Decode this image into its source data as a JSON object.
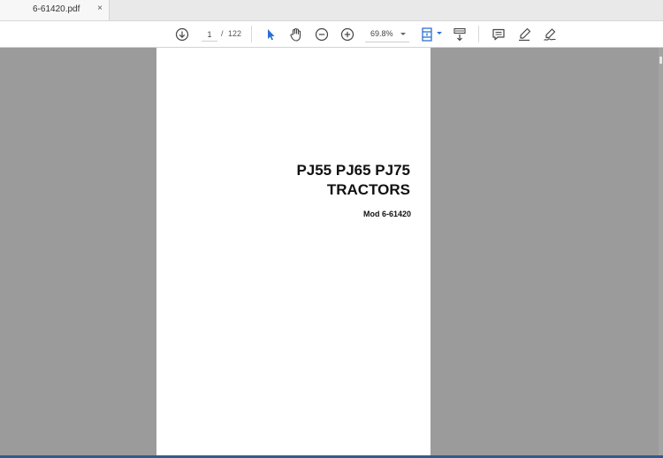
{
  "tab": {
    "title": "6-61420.pdf",
    "close_glyph": "×"
  },
  "toolbar": {
    "download_icon": "download-circle-icon",
    "page_current": "1",
    "page_separator": "/",
    "page_total": "122",
    "select_icon": "cursor-arrow-icon",
    "hand_icon": "hand-pan-icon",
    "zoom_out_icon": "zoom-out-circle-icon",
    "zoom_in_icon": "zoom-in-circle-icon",
    "zoom_value": "69.8%",
    "fit_icon": "fit-page-icon",
    "scroll_icon": "scroll-mode-icon",
    "comment_icon": "comment-icon",
    "highlight_icon": "highlight-pen-icon",
    "sign_icon": "sign-icon",
    "accent_color": "#2b6fd6"
  },
  "document": {
    "title_line1": "PJ55 PJ65 PJ75",
    "title_line2": "TRACTORS",
    "model": "Mod 6-61420"
  },
  "colors": {
    "background": "#9b9b9b",
    "page": "#ffffff",
    "tab_bar": "#e9e9e9",
    "toolbar": "#ffffff"
  }
}
